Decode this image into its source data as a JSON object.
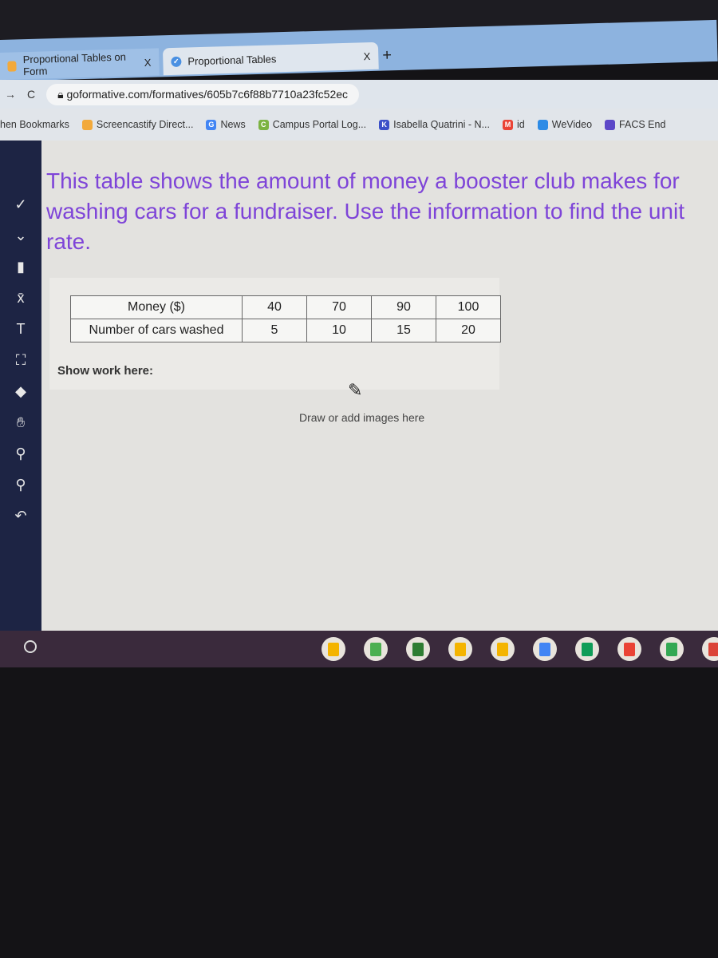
{
  "browser": {
    "tabs": [
      {
        "label": "Proportional Tables on Form",
        "close": "X"
      },
      {
        "label": "Proportional Tables",
        "close": "X"
      }
    ],
    "new_tab": "+",
    "url": "goformative.com/formatives/605b7c6f88b7710a23fc52ec",
    "bookmarks": [
      {
        "label": "hen Bookmarks",
        "icon": "",
        "color": ""
      },
      {
        "label": "Screencastify Direct...",
        "icon": "screencastify-icon",
        "color": "#f2a93b"
      },
      {
        "label": "News",
        "icon": "G",
        "color": "#4285f4"
      },
      {
        "label": "Campus Portal Log...",
        "icon": "C",
        "color": "#7cb342"
      },
      {
        "label": "Isabella Quatrini - N...",
        "icon": "K",
        "color": "#3b50c8"
      },
      {
        "label": "id",
        "icon": "M",
        "color": "#ea4335"
      },
      {
        "label": "WeVideo",
        "icon": "play",
        "color": "#2d8be6"
      },
      {
        "label": "FACS End",
        "icon": "list",
        "color": "#5c48c8"
      }
    ]
  },
  "toolbar_icons": [
    "check-icon",
    "chevron-icon",
    "highlighter-icon",
    "equation-icon",
    "text-icon",
    "crop-icon",
    "eraser-icon",
    "hand-icon",
    "zoom-in-icon",
    "zoom-out-icon",
    "undo-icon"
  ],
  "question": "This table shows the amount of money a booster club makes for washing cars for a fundraiser.  Use the information to find the unit rate.",
  "table": {
    "rows": [
      {
        "label": "Money ($)",
        "values": [
          "40",
          "70",
          "90",
          "100"
        ]
      },
      {
        "label": "Number of cars washed",
        "values": [
          "5",
          "10",
          "15",
          "20"
        ]
      }
    ]
  },
  "work": {
    "label": "Show work here:",
    "draw_hint": "Draw or add images here"
  },
  "accent": "#7e44d8",
  "shelf_apps": [
    "keep",
    "classroom",
    "geogebra",
    "keep",
    "slides",
    "docs",
    "sheets",
    "gmail",
    "drive",
    "chrome"
  ]
}
